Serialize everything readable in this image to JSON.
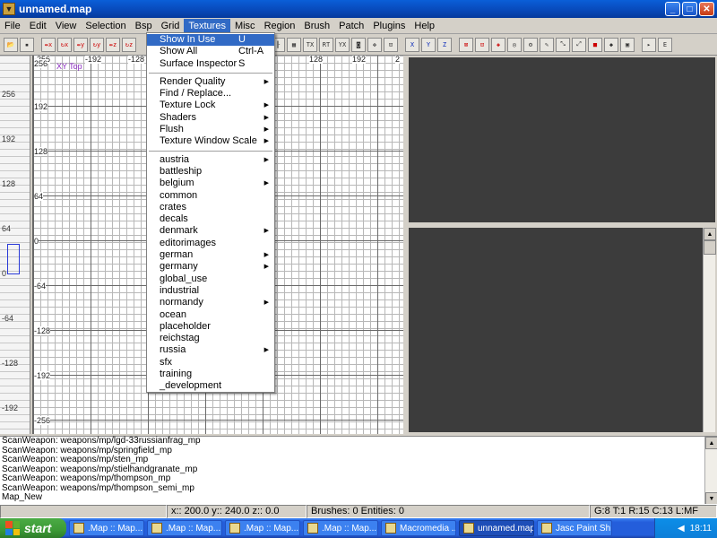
{
  "window": {
    "title": "unnamed.map"
  },
  "menubar": [
    "File",
    "Edit",
    "View",
    "Selection",
    "Bsp",
    "Grid",
    "Textures",
    "Misc",
    "Region",
    "Brush",
    "Patch",
    "Plugins",
    "Help"
  ],
  "textures_menu": {
    "group1": [
      {
        "label": "Show In Use",
        "accel": "U"
      },
      {
        "label": "Show All",
        "accel": "Ctrl-A"
      },
      {
        "label": "Surface Inspector",
        "accel": "S"
      }
    ],
    "group2": [
      {
        "label": "Render Quality",
        "sub": true
      },
      {
        "label": "Find / Replace...",
        "sub": false
      },
      {
        "label": "Texture Lock",
        "sub": true
      },
      {
        "label": "Shaders",
        "sub": true
      },
      {
        "label": "Flush",
        "sub": true
      },
      {
        "label": "Texture Window Scale",
        "sub": true
      }
    ],
    "group3": [
      {
        "label": "austria",
        "sub": true
      },
      {
        "label": "battleship",
        "sub": false
      },
      {
        "label": "belgium",
        "sub": true
      },
      {
        "label": "common",
        "sub": false
      },
      {
        "label": "crates",
        "sub": false
      },
      {
        "label": "decals",
        "sub": false
      },
      {
        "label": "denmark",
        "sub": true
      },
      {
        "label": "editorimages",
        "sub": false
      },
      {
        "label": "german",
        "sub": true
      },
      {
        "label": "germany",
        "sub": true
      },
      {
        "label": "global_use",
        "sub": false
      },
      {
        "label": "industrial",
        "sub": false
      },
      {
        "label": "normandy",
        "sub": true
      },
      {
        "label": "ocean",
        "sub": false
      },
      {
        "label": "placeholder",
        "sub": false
      },
      {
        "label": "reichstag",
        "sub": false
      },
      {
        "label": "russia",
        "sub": true
      },
      {
        "label": "sfx",
        "sub": false
      },
      {
        "label": "training",
        "sub": false
      },
      {
        "label": "_development",
        "sub": false
      }
    ]
  },
  "xy_view": {
    "tag": "XY Top",
    "top_coords": [
      "-256",
      "-192",
      "-128",
      "128",
      "192",
      "2"
    ],
    "left_coords": [
      "256",
      "192",
      "128",
      "64",
      "0",
      "-64",
      "-128",
      "-192",
      "-256"
    ]
  },
  "z_view": {
    "labels": [
      "256",
      "192",
      "128",
      "64",
      "0",
      "-64",
      "-128",
      "-192"
    ]
  },
  "console": {
    "lines": [
      "ScanWeapon: weapons/mp/lgd-33russianfrag_mp",
      "ScanWeapon: weapons/mp/springfield_mp",
      "ScanWeapon: weapons/mp/sten_mp",
      "ScanWeapon: weapons/mp/stielhandgranate_mp",
      "ScanWeapon: weapons/mp/thompson_mp",
      "ScanWeapon: weapons/mp/thompson_semi_mp",
      "Map_New"
    ]
  },
  "statusbar": {
    "coords": "x:: 200.0  y:: 240.0  z:: 0.0",
    "counts": "Brushes: 0 Entities: 0",
    "grid": "G:8 T:1 R:15 C:13 L:MF"
  },
  "taskbar": {
    "start": "start",
    "buttons": [
      ".Map :: Map...",
      ".Map :: Map...",
      ".Map :: Map...",
      ".Map :: Map...",
      "Macromedia ...",
      "unnamed.map",
      "Jasc Paint Sh..."
    ],
    "clock": "18:11"
  },
  "colors": {
    "menu_highlight": "#316ac5",
    "brush_outline": "#2a3ad8",
    "view_tag": "#8a2ac0",
    "dark_panel": "#3c3c3c"
  }
}
